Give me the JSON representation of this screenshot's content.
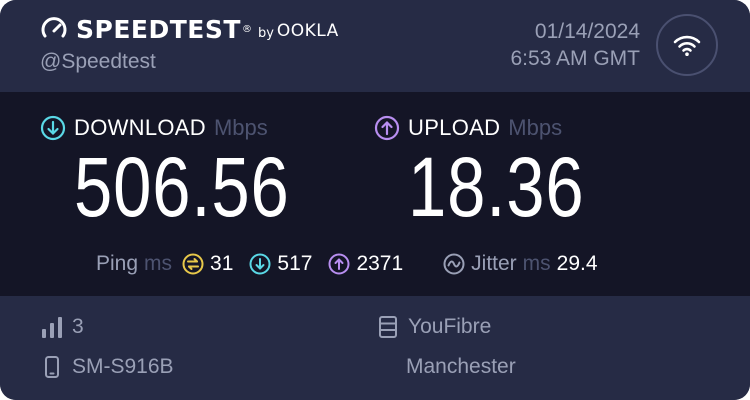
{
  "brand": {
    "name": "SPEEDTEST",
    "trademark": "®",
    "by": "by",
    "company": "OOKLA",
    "icon": "speedometer-icon"
  },
  "header": {
    "handle": "@Speedtest",
    "date": "01/14/2024",
    "time": "6:53 AM GMT",
    "connection_icon": "wifi-icon"
  },
  "download": {
    "label": "DOWNLOAD",
    "unit": "Mbps",
    "value": "506.56",
    "icon": "download-arrow-icon",
    "color": "#5ad8e6"
  },
  "upload": {
    "label": "UPLOAD",
    "unit": "Mbps",
    "value": "18.36",
    "icon": "upload-arrow-icon",
    "color": "#b88ef0"
  },
  "ping": {
    "label": "Ping",
    "unit": "ms",
    "idle": "31",
    "download": "517",
    "upload": "2371",
    "idle_icon": "idle-latency-icon",
    "idle_color": "#e8c84a"
  },
  "jitter": {
    "label": "Jitter",
    "unit": "ms",
    "value": "29.4",
    "icon": "jitter-wave-icon"
  },
  "footer": {
    "signal_strength": "3",
    "signal_icon": "signal-bars-icon",
    "device": "SM-S916B",
    "device_icon": "phone-icon",
    "provider": "YouFibre",
    "provider_icon": "server-icon",
    "location": "Manchester"
  },
  "colors": {
    "card_bg": "#262b45",
    "results_bg": "#141526",
    "muted_text": "#9aa0b6",
    "dim_text": "#4d5370"
  }
}
